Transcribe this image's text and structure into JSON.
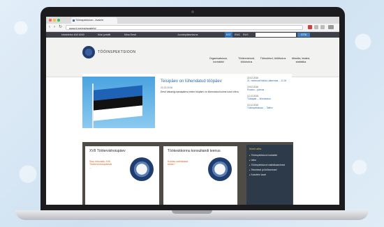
{
  "browser": {
    "tab_title": "Tööinspektsioon - Avaleht",
    "url": "www.ti.ee/est/avaleht/",
    "back_icon": "arrow-left-icon",
    "forward_icon": "arrow-right-icon",
    "reload_icon": "reload-icon"
  },
  "sitebar": {
    "items": [
      "Infotelefon 640 6000",
      "Küsi juristilt",
      "Mina Eesti",
      "Juurdepääsetavus"
    ],
    "languages": [
      "EST",
      "ENG",
      "RUS"
    ],
    "search_button": "OTSI"
  },
  "header": {
    "logo_text": "TÖÖINSPEKTSIOON",
    "nav": [
      "Organisatsioon, kontaktid",
      "Töötervishoid, tööohutus",
      "Töösuhted, tööõhutus",
      "Meedia, teated, statistika"
    ]
  },
  "main": {
    "headline": "Teisipäev on lühendatud tööpäev",
    "date": "22.02.2016",
    "summary": "Eesti Vabariigi aastapäeva eelne tööpäev on lühendatud kolme tunni võrra.",
    "side_news": [
      {
        "date": "22.02.2016",
        "link": "21. veebruaril lekkis Läänemaa ... 11.00"
      },
      {
        "date": "19.02.2016",
        "link": "Puuduv ...pärnus"
      },
      {
        "date": "12.12.2015",
        "link": "Töötajate ... lühendatud"
      },
      {
        "date": "10.12.2015",
        "link": "Tööinspektsioon ... Tallinn"
      }
    ]
  },
  "lower": {
    "card1_title": "XVII Töötervishoiupäev",
    "card1_text": "Sisu infovaldu XVII Töötervishoiupäeval ...",
    "card2_title": "Töökeskkonnu konsultandi teenus",
    "card2_text": "Kuidas valmistada tööks?",
    "panel_title": "Kiirelt alles",
    "panel_items": [
      "Tööinspektsiooni kontaktid",
      "Vaba",
      "Tööinspektsiooni statistikaandmed",
      "Teksimisel ja tööõnnetusel",
      "Kodulehe kaart"
    ]
  },
  "colors": {
    "flag_blue": "#1f63b6",
    "flag_black": "#111111",
    "flag_white": "#ffffff",
    "link_blue": "#2c6ba8",
    "panel_bg": "#2d3a4a"
  }
}
